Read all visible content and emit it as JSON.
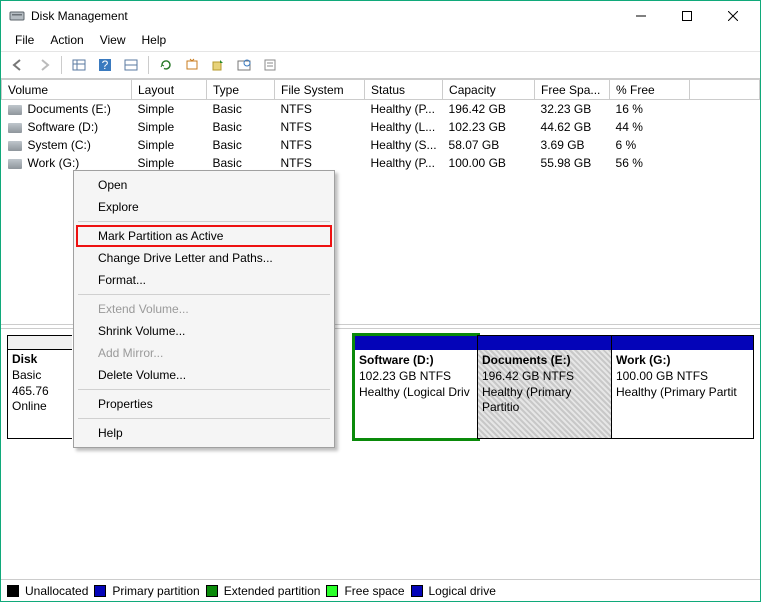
{
  "window": {
    "title": "Disk Management"
  },
  "menu": {
    "file": "File",
    "action": "Action",
    "view": "View",
    "help": "Help"
  },
  "columns": {
    "volume": "Volume",
    "layout": "Layout",
    "type": "Type",
    "fs": "File System",
    "status": "Status",
    "capacity": "Capacity",
    "free": "Free Spa...",
    "pct": "% Free"
  },
  "rows": [
    {
      "volume": "Documents (E:)",
      "layout": "Simple",
      "type": "Basic",
      "fs": "NTFS",
      "status": "Healthy (P...",
      "capacity": "196.42 GB",
      "free": "32.23 GB",
      "pct": "16 %"
    },
    {
      "volume": "Software (D:)",
      "layout": "Simple",
      "type": "Basic",
      "fs": "NTFS",
      "status": "Healthy (L...",
      "capacity": "102.23 GB",
      "free": "44.62 GB",
      "pct": "44 %"
    },
    {
      "volume": "System (C:)",
      "layout": "Simple",
      "type": "Basic",
      "fs": "NTFS",
      "status": "Healthy (S...",
      "capacity": "58.07 GB",
      "free": "3.69 GB",
      "pct": "6 %"
    },
    {
      "volume": "Work (G:)",
      "layout": "Simple",
      "type": "Basic",
      "fs": "NTFS",
      "status": "Healthy (P...",
      "capacity": "100.00 GB",
      "free": "55.98 GB",
      "pct": "56 %"
    }
  ],
  "diskinfo": {
    "title": "Disk",
    "type": "Basic",
    "size": "465.76",
    "status": "Online"
  },
  "parts": {
    "soft": {
      "name": "Software  (D:)",
      "size": "102.23 GB NTFS",
      "health": "Healthy (Logical Driv"
    },
    "docs": {
      "name": "Documents  (E:)",
      "size": "196.42 GB NTFS",
      "health": "Healthy (Primary Partitio"
    },
    "work": {
      "name": "Work  (G:)",
      "size": "100.00 GB NTFS",
      "health": "Healthy (Primary Partit"
    }
  },
  "legend": {
    "unalloc": "Unallocated",
    "primary": "Primary partition",
    "ext": "Extended partition",
    "free": "Free space",
    "logical": "Logical drive"
  },
  "ctx": {
    "open": "Open",
    "explore": "Explore",
    "active": "Mark Partition as Active",
    "change": "Change Drive Letter and Paths...",
    "format": "Format...",
    "extend": "Extend Volume...",
    "shrink": "Shrink Volume...",
    "mirror": "Add Mirror...",
    "delete": "Delete Volume...",
    "props": "Properties",
    "help": "Help"
  }
}
